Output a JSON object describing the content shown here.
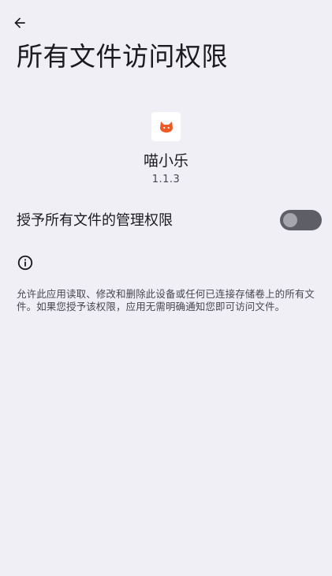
{
  "header": {
    "back_icon": "arrow-left-icon",
    "title": "所有文件访问权限"
  },
  "app": {
    "icon": "cat-face-icon",
    "name": "喵小乐",
    "version": "1.1.3"
  },
  "permission": {
    "label": "授予所有文件的管理权限",
    "enabled": false
  },
  "info": {
    "icon": "info-icon",
    "description": "允许此应用读取、修改和删除此设备或任何已连接存储卷上的所有文件。如果您授予该权限，应用无需明确通知您即可访问文件。"
  },
  "colors": {
    "background": "#f0eff5",
    "switch_track_off": "#5e5e66",
    "switch_thumb_off": "#a5a5ad",
    "app_icon_accent": "#ee5a24"
  }
}
